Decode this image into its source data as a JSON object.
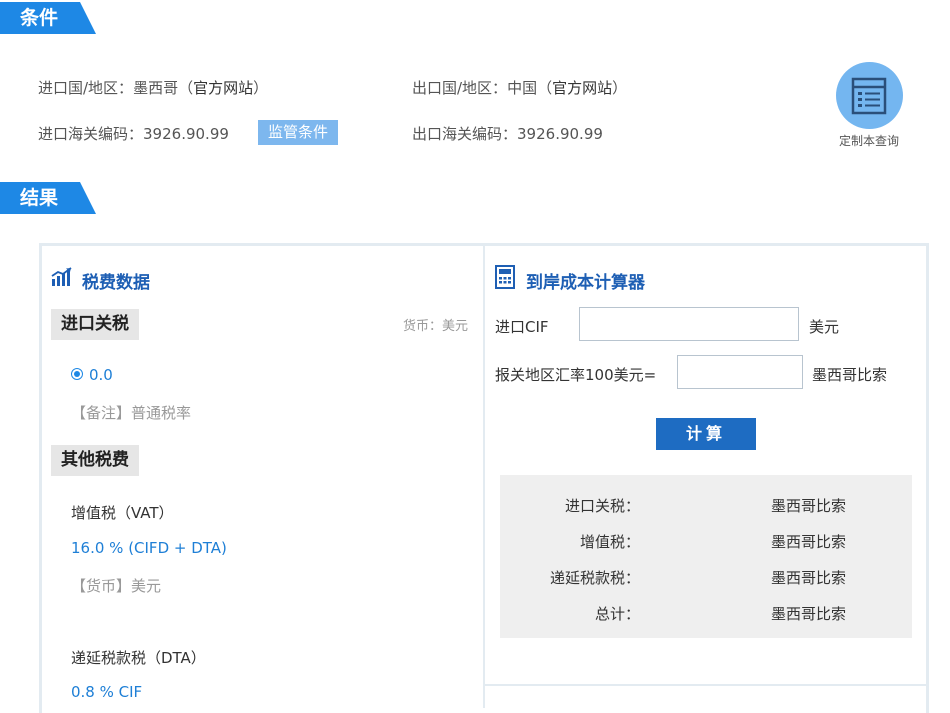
{
  "sections": {
    "conditions": "条件",
    "results": "结果"
  },
  "conditions": {
    "import_label": "进口国/地区：",
    "import_country": "墨西哥",
    "export_label": "出口国/地区：",
    "export_country": "中国",
    "paren_open": "（",
    "paren_close": "）",
    "official_site": "官方网站",
    "import_hs_label": "进口海关编码：",
    "import_hs": "3926.90.99",
    "export_hs_label": "出口海关编码：",
    "export_hs": "3926.90.99",
    "regulatory_badge": "监管条件",
    "custom_query": "定制本查询"
  },
  "tax_panel": {
    "title": "税费数据",
    "import_duty_head": "进口关税",
    "currency_note": "货币：美元",
    "import_duty_rate": "0.0",
    "remark": "【备注】普通税率",
    "other_head": "其他税费",
    "vat_name": "增值税（VAT）",
    "vat_rate": "16.0 % (CIFD + DTA)",
    "vat_currency": "【货币】美元",
    "dta_name": "递延税款税（DTA）",
    "dta_rate": "0.8 % CIF"
  },
  "calculator": {
    "title": "到岸成本计算器",
    "cif_label": "进口CIF",
    "cif_value": "",
    "cif_unit": "美元",
    "rate_label": "报关地区汇率100美元=",
    "rate_value": "",
    "rate_unit": "墨西哥比索",
    "button": "计算",
    "results": [
      {
        "label": "进口关税：",
        "value": "墨西哥比索"
      },
      {
        "label": "增值税：",
        "value": "墨西哥比索"
      },
      {
        "label": "递延税款税：",
        "value": "墨西哥比索"
      },
      {
        "label": "总计：",
        "value": "墨西哥比索"
      }
    ]
  },
  "icons": {
    "chart": "bar-chart-icon",
    "calculator": "calculator-icon",
    "list": "list-icon"
  },
  "colors": {
    "accent": "#1e88e5",
    "title_blue": "#1e5fb4",
    "link_blue": "#1e7fd6",
    "button_blue": "#1e6cc2",
    "badge": "#7db7ee"
  }
}
